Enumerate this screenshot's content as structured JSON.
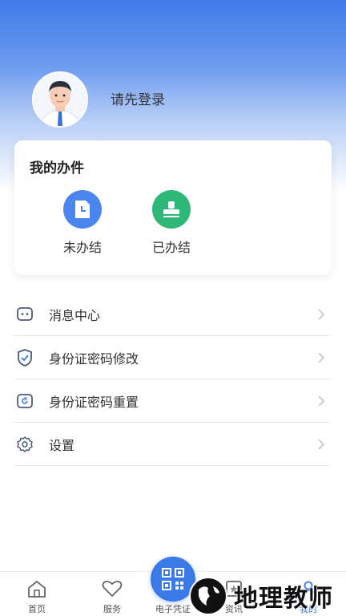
{
  "profile": {
    "login_prompt": "请先登录",
    "avatar_icon": "user-avatar"
  },
  "my_cases": {
    "title": "我的办件",
    "items": [
      {
        "label": "未办结",
        "icon": "pending-doc-icon",
        "color": "#4a86ee"
      },
      {
        "label": "已办结",
        "icon": "stamp-icon",
        "color": "#2eb878"
      }
    ]
  },
  "menu": {
    "items": [
      {
        "label": "消息中心",
        "icon": "message-icon"
      },
      {
        "label": "身份证密码修改",
        "icon": "shield-check-icon"
      },
      {
        "label": "身份证密码重置",
        "icon": "reset-icon"
      },
      {
        "label": "设置",
        "icon": "gear-icon"
      }
    ]
  },
  "tabbar": {
    "tabs": [
      {
        "label": "首页",
        "icon": "home-icon"
      },
      {
        "label": "服务",
        "icon": "heart-icon"
      },
      {
        "label": "电子凭证",
        "icon": "qr-code-icon"
      },
      {
        "label": "资讯",
        "icon": "news-icon"
      },
      {
        "label": "我的",
        "icon": "person-icon",
        "active": true
      }
    ],
    "accent": "#3a7ae8"
  },
  "watermark": {
    "text": "地理教师"
  }
}
